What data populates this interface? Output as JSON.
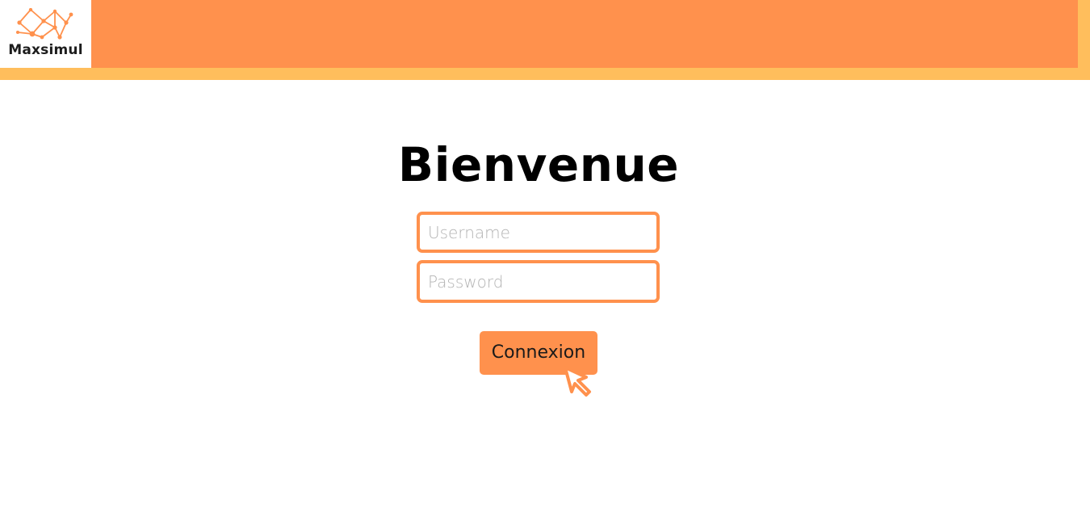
{
  "header": {
    "logo_text": "Maxsimul",
    "colors": {
      "bar": "#ff914d",
      "band": "#ffbe5c"
    }
  },
  "login": {
    "title": "Bienvenue",
    "username": {
      "placeholder": "Username",
      "value": ""
    },
    "password": {
      "placeholder": "Password",
      "value": ""
    },
    "submit_label": "Connexion",
    "accent_color": "#ff914d"
  },
  "icons": {
    "logo": "network-nodes-icon",
    "cursor": "pointer-cursor-icon"
  }
}
